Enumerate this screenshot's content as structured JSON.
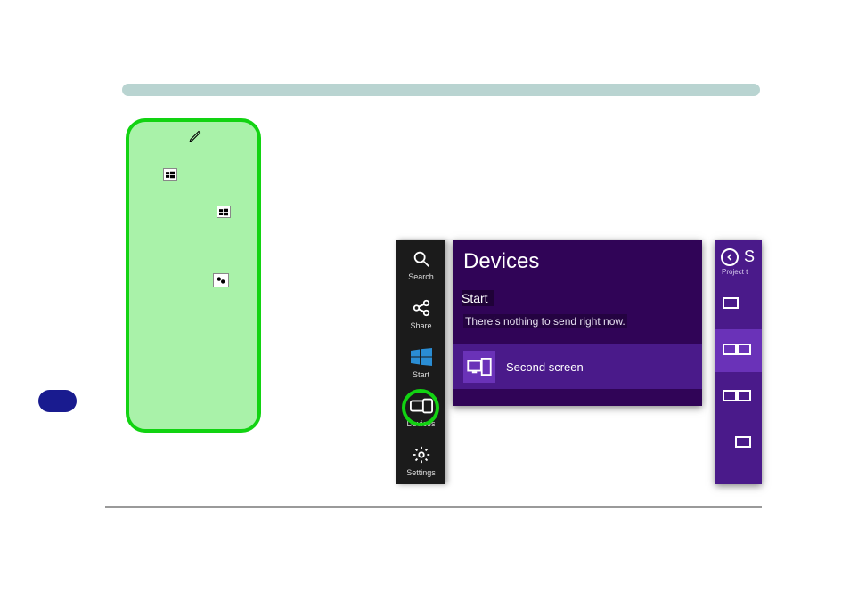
{
  "charms": {
    "search": "Search",
    "share": "Share",
    "start": "Start",
    "devices": "Devices",
    "settings": "Settings"
  },
  "devices_panel": {
    "title": "Devices",
    "subtitle": "Start",
    "message": "There's nothing to send right now.",
    "second_screen": "Second screen"
  },
  "project_panel": {
    "title_fragment": "S",
    "subtitle_fragment": "Project t"
  }
}
